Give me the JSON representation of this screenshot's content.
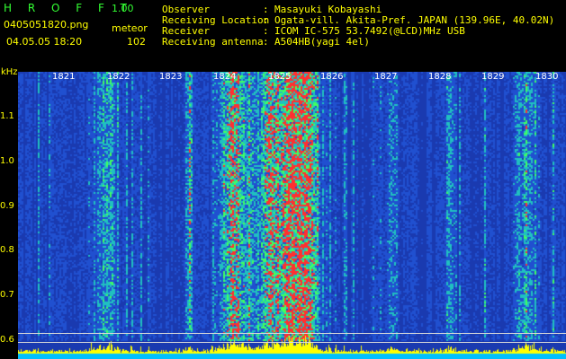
{
  "header": {
    "app_title": "H R O F F T",
    "app_version": "1.00",
    "file_name": "0405051820.png",
    "meteor_label": "meteor",
    "datetime": "04.05.05 18:20",
    "meteor_count": "102"
  },
  "info": [
    {
      "label": "Observer",
      "value": "Masayuki Kobayashi"
    },
    {
      "label": "Receiving Location",
      "value": "Ogata-vill. Akita-Pref. JAPAN (139.96E, 40.02N)"
    },
    {
      "label": "Receiver",
      "value": "ICOM IC-575 53.7492(@LCD)MHz USB"
    },
    {
      "label": "Receiving antenna",
      "value": "A504HB(yagi 4el)"
    }
  ],
  "info_separator": ":",
  "spectrogram": {
    "y_unit": "kHz",
    "y_ticks": [
      "1.1",
      "1.0",
      "0.9",
      "0.8",
      "0.7",
      "0.6"
    ],
    "x_ticks": [
      "1821",
      "1822",
      "1823",
      "1824",
      "1825",
      "1826",
      "1827",
      "1828",
      "1829",
      "1830"
    ],
    "colors": {
      "background": "#1a3ab0",
      "noise_low": "#2050d0",
      "signal_mid": "#20c0c0",
      "signal_high": "#40ff60",
      "peak": "#ff3030",
      "baseline": "#ffff00",
      "floor": "#00c0ff"
    }
  }
}
